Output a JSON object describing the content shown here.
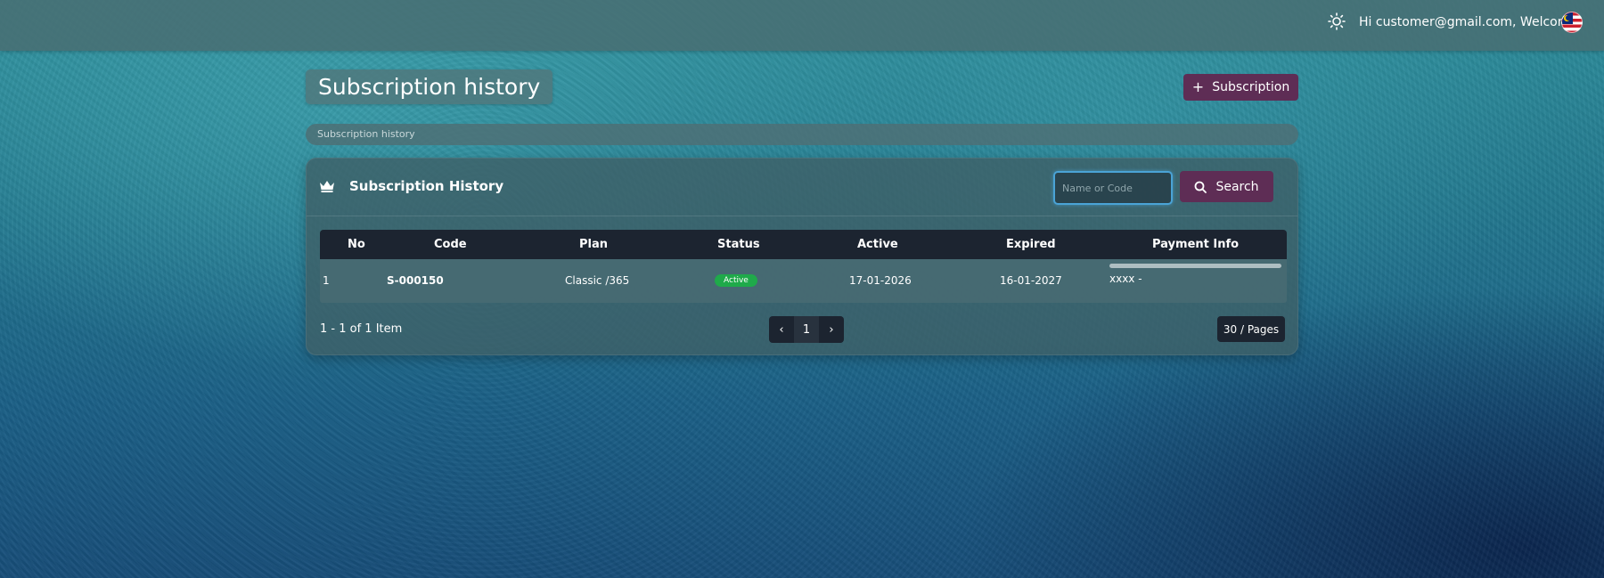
{
  "header": {
    "welcome_text": "Hi customer@gmail.com, Welcome!",
    "theme_icon": "sun-icon",
    "language_flag": "malaysia-flag-icon"
  },
  "page": {
    "title": "Subscription history",
    "add_button_label": "Subscription",
    "breadcrumb": "Subscription history"
  },
  "card": {
    "title": "Subscription History",
    "search_placeholder": "Name or Code",
    "search_value": "",
    "search_button_label": "Search"
  },
  "table": {
    "columns": [
      "No",
      "Code",
      "Plan",
      "Status",
      "Active",
      "Expired",
      "Payment Info"
    ],
    "rows": [
      {
        "no": "1",
        "code": "S-000150",
        "plan": "Classic /365",
        "status": "Active",
        "active": "17-01-2026",
        "expired": "16-01-2027",
        "payment_info": "xxxx -"
      }
    ]
  },
  "footer": {
    "summary": "1 - 1 of 1 Item",
    "prev": "‹",
    "current_page": "1",
    "next": "›",
    "page_size": "30 / Pages"
  },
  "colors": {
    "accent_button": "#5e2d55",
    "status_active": "#1faa4a",
    "table_header": "#1c2430",
    "input_focus": "#4aa3d6"
  }
}
